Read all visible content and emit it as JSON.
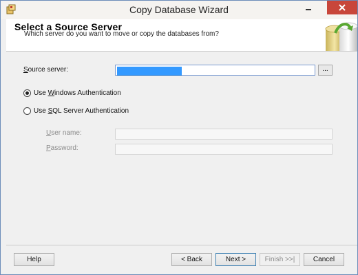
{
  "window": {
    "title": "Copy Database Wizard"
  },
  "header": {
    "title": "Select a Source Server",
    "subtitle": "Which server do you want to move or copy the databases from?"
  },
  "form": {
    "source_server_label_pre": "",
    "source_server_label_ul": "S",
    "source_server_label_post": "ource server:",
    "source_server_value": " ",
    "browse_label": "...",
    "auth_windows_pre": "Use ",
    "auth_windows_ul": "W",
    "auth_windows_post": "indows Authentication",
    "auth_windows_selected": true,
    "auth_sql_pre": "Use ",
    "auth_sql_ul": "S",
    "auth_sql_post": "QL Server Authentication",
    "auth_sql_selected": false,
    "username_label_ul": "U",
    "username_label_post": "ser name:",
    "username_value": "",
    "password_label_ul": "P",
    "password_label_post": "assword:",
    "password_value": ""
  },
  "footer": {
    "help": "Help",
    "back": "< Back",
    "next": "Next >",
    "finish": "Finish >>|",
    "cancel": "Cancel"
  }
}
